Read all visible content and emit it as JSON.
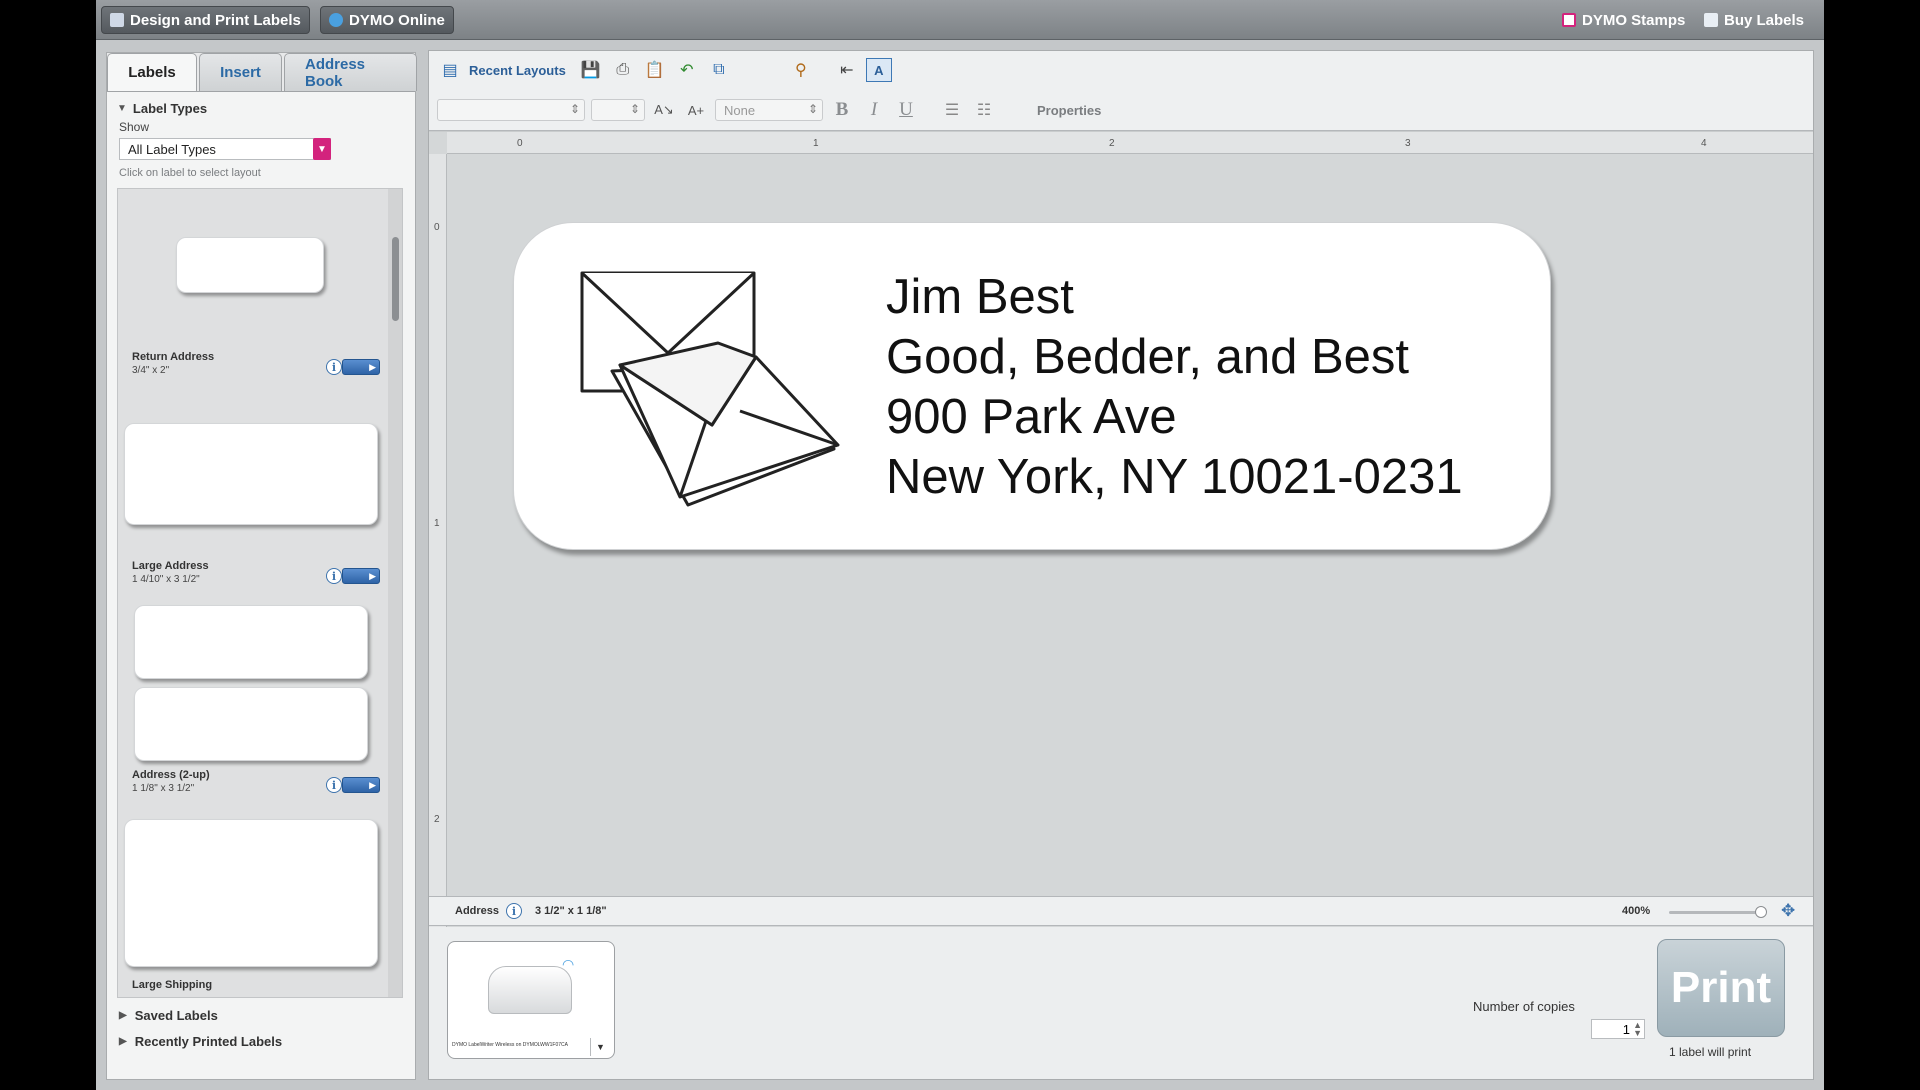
{
  "topbar": {
    "design_tab": "Design and Print Labels",
    "online_tab": "DYMO Online",
    "stamps": "DYMO Stamps",
    "buy": "Buy Labels"
  },
  "left_tabs": [
    "Labels",
    "Insert",
    "Address Book"
  ],
  "left": {
    "label_types": "Label Types",
    "show": "Show",
    "select_value": "All Label Types",
    "hint": "Click on label to select layout",
    "saved": "Saved Labels",
    "recent": "Recently Printed Labels"
  },
  "labels": [
    {
      "name": "Return Address",
      "size": "3/4\" x 2\""
    },
    {
      "name": "Large Address",
      "size": "1 4/10\" x 3 1/2\""
    },
    {
      "name": "Address (2-up)",
      "size": "1 1/8\" x 3 1/2\""
    },
    {
      "name": "Large Shipping",
      "size": ""
    }
  ],
  "toolbar": {
    "recent_layouts": "Recent Layouts",
    "font_size_none": "None",
    "properties": "Properties"
  },
  "ruler": {
    "top": [
      "0",
      "1",
      "2",
      "3",
      "4"
    ],
    "left": [
      "0",
      "1",
      "2"
    ]
  },
  "address_lines": [
    "Jim Best",
    "Good, Bedder, and Best",
    "900 Park Ave",
    "New York, NY 10021-0231"
  ],
  "status": {
    "label_type": "Address",
    "size": "3 1/2\" x 1 1/8\"",
    "zoom": "400%"
  },
  "printer": {
    "name": "DYMO LabelWriter Wireless on DYMOLWW1F07CA"
  },
  "print": {
    "copies_label": "Number of copies",
    "copies": "1",
    "button": "Print",
    "summary": "1 label will print"
  }
}
